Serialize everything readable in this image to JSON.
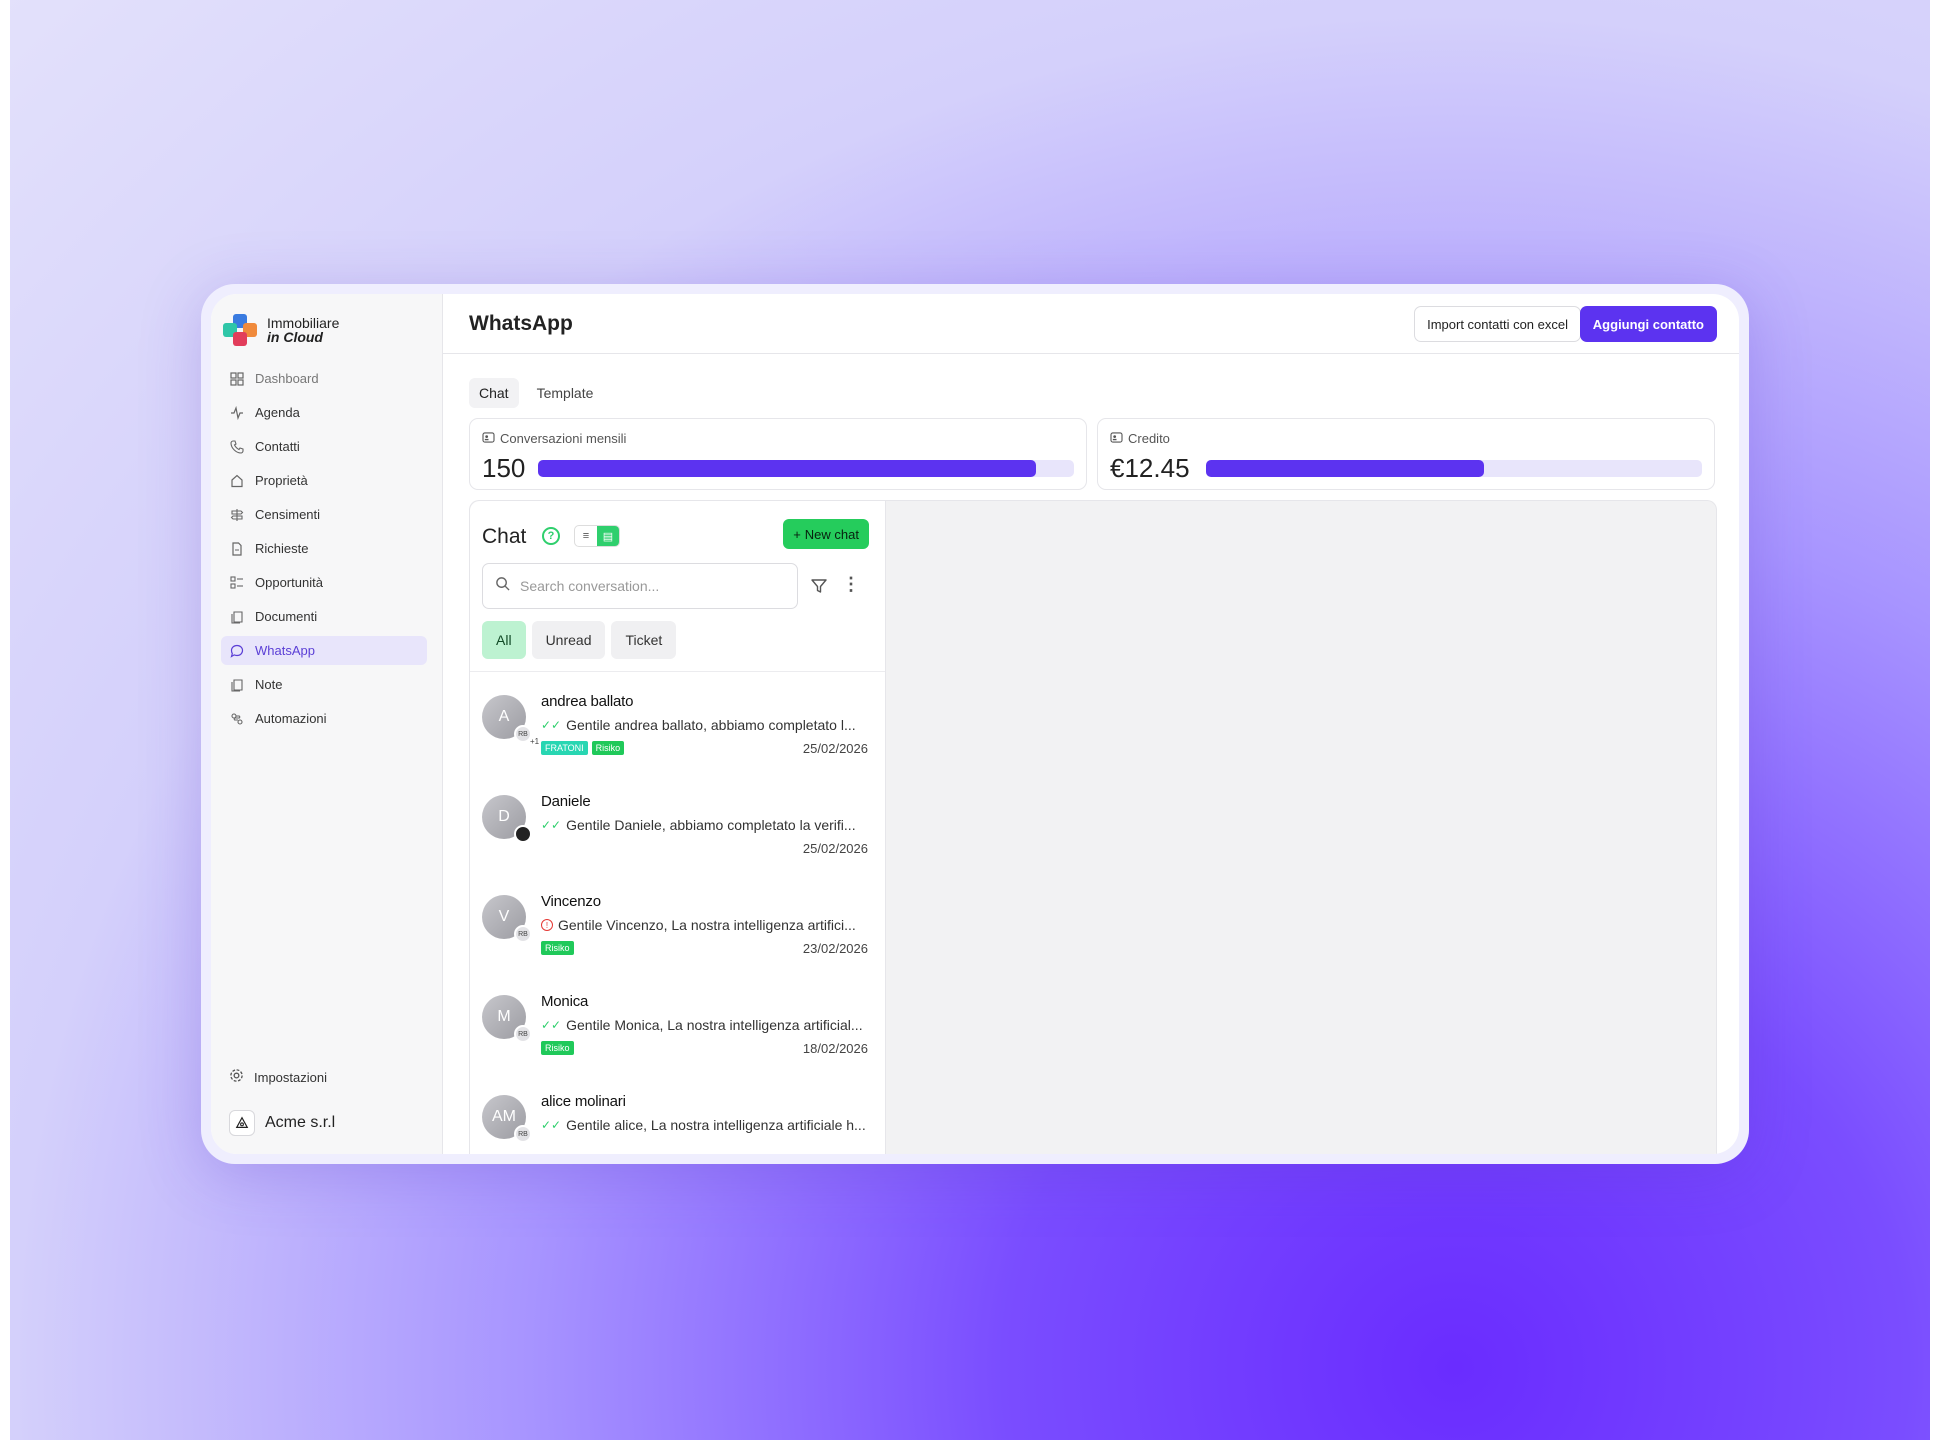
{
  "app": {
    "logo_line1": "Immobiliare",
    "logo_line2": "in Cloud"
  },
  "sidebar": {
    "items": [
      {
        "label": "Dashboard",
        "icon": "grid-icon"
      },
      {
        "label": "Agenda",
        "icon": "activity-icon"
      },
      {
        "label": "Contatti",
        "icon": "phone-icon"
      },
      {
        "label": "Proprietà",
        "icon": "home-icon"
      },
      {
        "label": "Censimenti",
        "icon": "signpost-icon"
      },
      {
        "label": "Richieste",
        "icon": "file-icon"
      },
      {
        "label": "Opportunità",
        "icon": "kanban-icon"
      },
      {
        "label": "Documenti",
        "icon": "documents-icon"
      },
      {
        "label": "WhatsApp",
        "icon": "chat-bubble-icon"
      },
      {
        "label": "Note",
        "icon": "note-icon"
      },
      {
        "label": "Automazioni",
        "icon": "automation-icon"
      }
    ],
    "active": "WhatsApp",
    "settings_label": "Impostazioni",
    "org_name": "Acme s.r.l"
  },
  "header": {
    "title": "WhatsApp",
    "import_label": "Import contatti con excel",
    "add_label": "Aggiungi contatto"
  },
  "tabs": [
    {
      "label": "Chat",
      "active": true
    },
    {
      "label": "Template",
      "active": false
    }
  ],
  "stats": {
    "conversations": {
      "label": "Conversazioni mensili",
      "value": "150",
      "progress": 0.93
    },
    "credit": {
      "label": "Credito",
      "value": "€12.45",
      "progress": 0.56
    }
  },
  "chat": {
    "title": "Chat",
    "new_chat_label": "New chat",
    "search_placeholder": "Search conversation...",
    "filters": [
      {
        "label": "All",
        "active": true
      },
      {
        "label": "Unread",
        "active": false
      },
      {
        "label": "Ticket",
        "active": false
      }
    ],
    "conversations": [
      {
        "initials": "A",
        "name": "andrea ballato",
        "message": "Gentile andrea ballato, abbiamo completato l...",
        "status": "sent",
        "agent": "RB",
        "extra": "+1",
        "tags": [
          "FRATONI",
          "Risiko"
        ],
        "date": "25/02/2026"
      },
      {
        "initials": "D",
        "name": "Daniele",
        "message": "Gentile Daniele, abbiamo completato la verifi...",
        "status": "sent",
        "agent": "",
        "extra": "",
        "tags": [],
        "date": "25/02/2026"
      },
      {
        "initials": "V",
        "name": "Vincenzo",
        "message": "Gentile Vincenzo, La nostra intelligenza artifici...",
        "status": "error",
        "agent": "RB",
        "extra": "",
        "tags": [
          "Risiko"
        ],
        "date": "23/02/2026"
      },
      {
        "initials": "M",
        "name": "Monica",
        "message": "Gentile Monica, La nostra intelligenza artificial...",
        "status": "sent",
        "agent": "RB",
        "extra": "",
        "tags": [
          "Risiko"
        ],
        "date": "18/02/2026"
      },
      {
        "initials": "AM",
        "name": "alice molinari",
        "message": "Gentile alice, La nostra intelligenza artificiale h...",
        "status": "sent",
        "agent": "RB",
        "extra": "",
        "tags": [],
        "date": ""
      }
    ]
  },
  "colors": {
    "accent": "#5c33f0",
    "whatsapp_green": "#25cc5c",
    "active_nav_bg": "#e8e5fb"
  }
}
